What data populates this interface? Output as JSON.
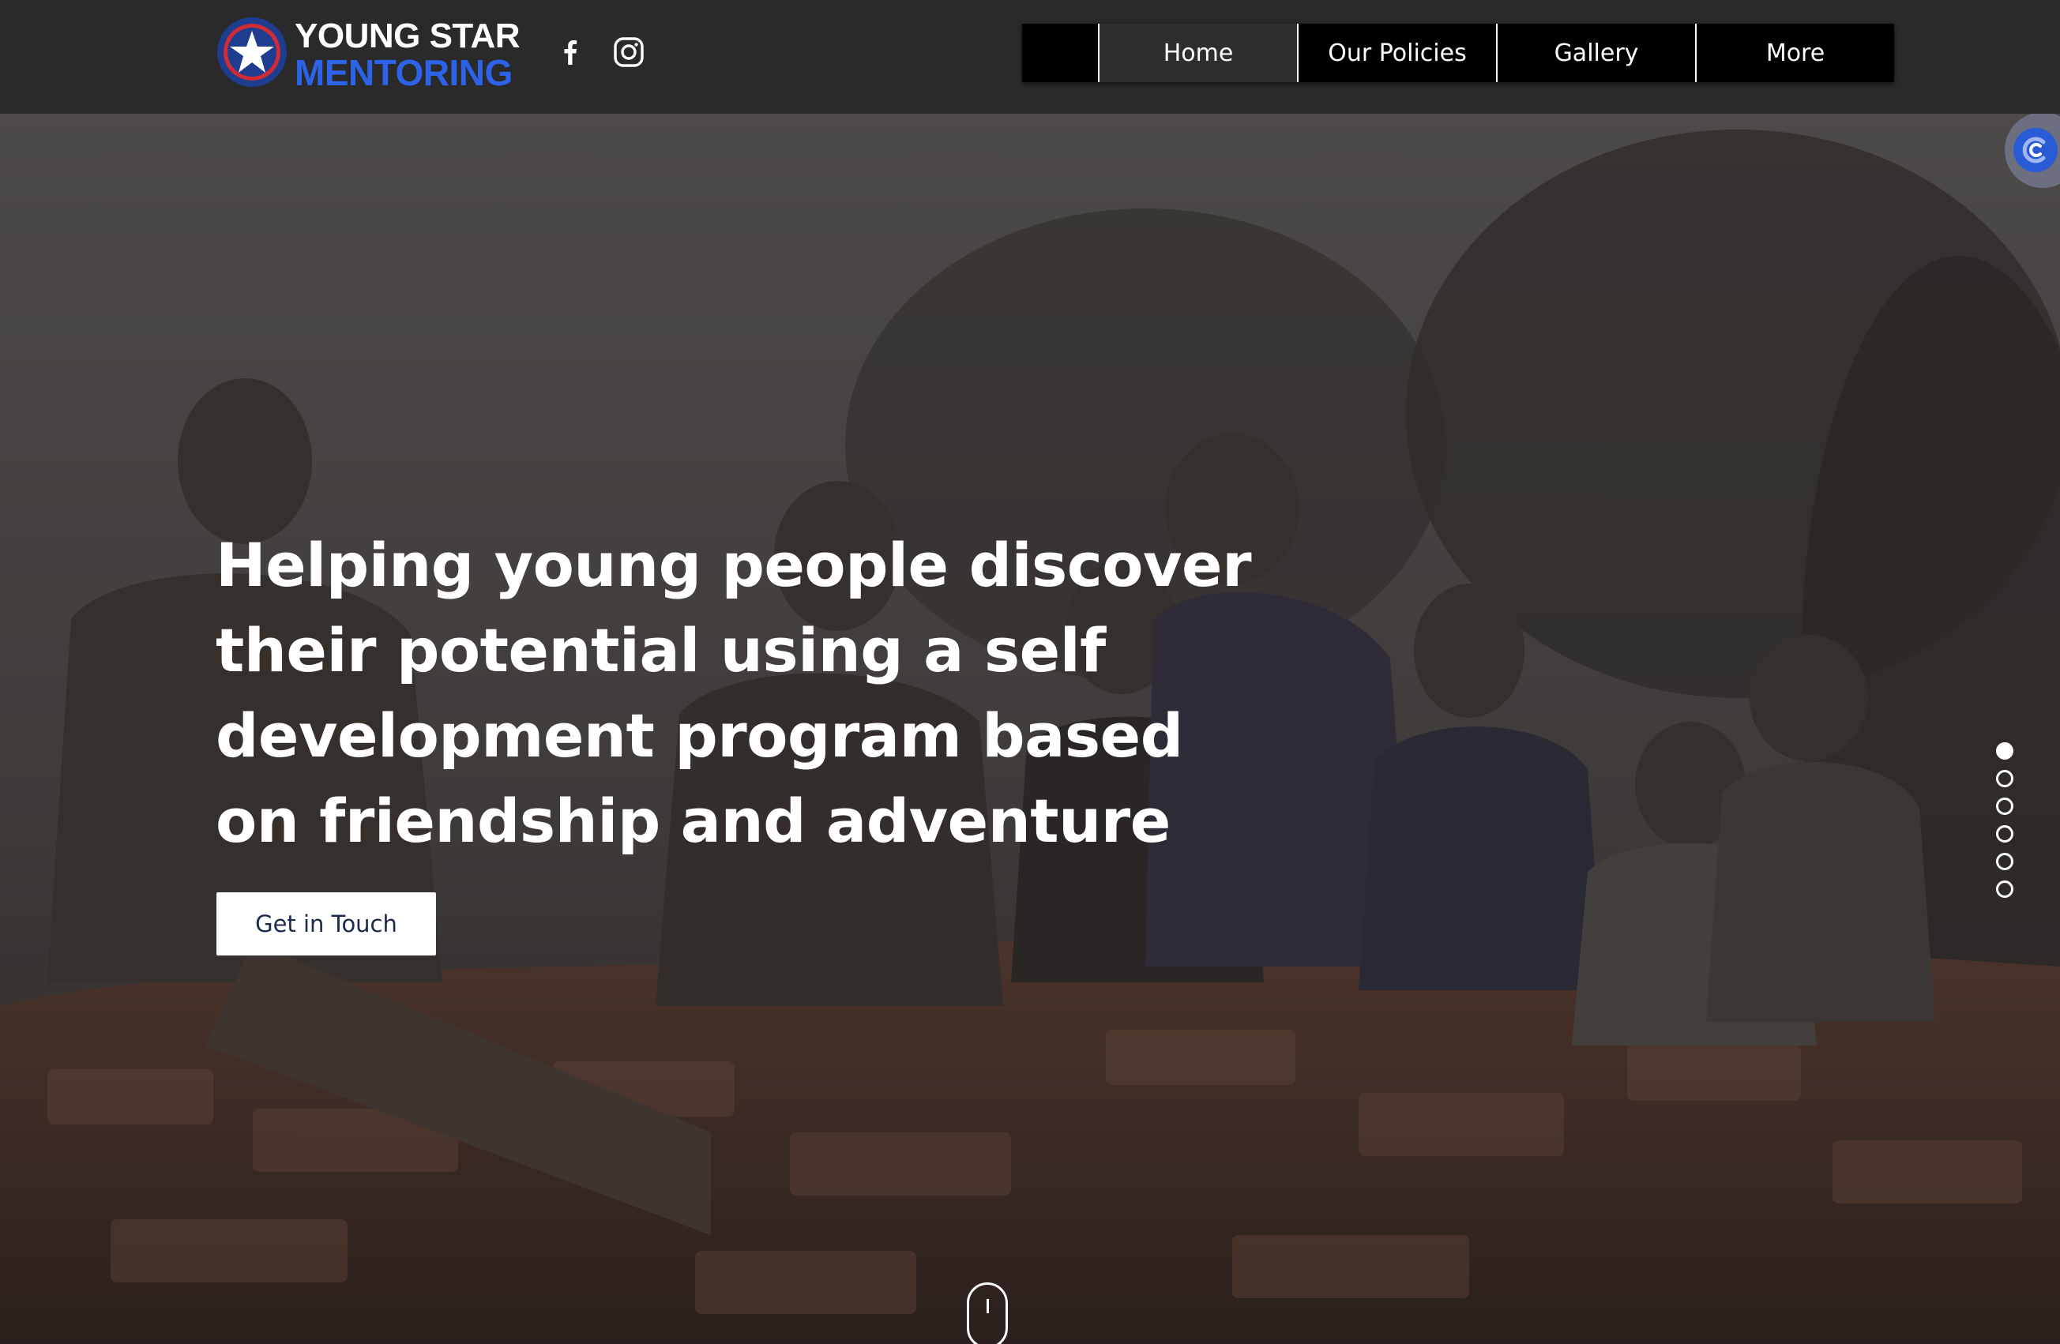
{
  "brand": {
    "name_line1": "YOUNG STAR",
    "name_line2": "MENTORING",
    "colors": {
      "navy": "#1f3d8f",
      "red": "#d12b36",
      "blue": "#2d63e8"
    },
    "icon": "star-badge-icon"
  },
  "social": [
    {
      "name": "facebook",
      "icon": "facebook-icon"
    },
    {
      "name": "instagram",
      "icon": "instagram-icon"
    }
  ],
  "nav": {
    "items": [
      {
        "label": "Home",
        "active": true
      },
      {
        "label": "Our Policies",
        "active": false
      },
      {
        "label": "Gallery",
        "active": false
      },
      {
        "label": "More",
        "active": false
      }
    ]
  },
  "hero": {
    "heading": "Helping young people discover their potential using a self development program based on friendship and adventure",
    "cta_label": "Get in Touch",
    "overlay_color": "#1e1c1b"
  },
  "section_anchors": {
    "count": 6,
    "active_index": 0
  },
  "icons": {
    "chat": "chat-bubble-icon",
    "scroll": "scroll-down-icon"
  }
}
